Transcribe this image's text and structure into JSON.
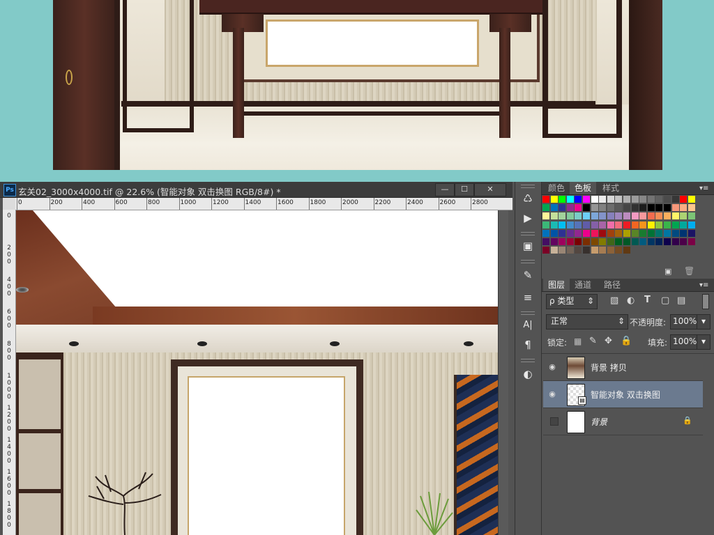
{
  "window": {
    "app_icon": "Ps",
    "title": "玄关02_3000x4000.tif @ 22.6% (智能对象 双击换图  RGB/8#) *",
    "minimize": "—",
    "restore": "☐",
    "close": "✕"
  },
  "ruler": {
    "horizontal": [
      "0",
      "200",
      "400",
      "600",
      "800",
      "1000",
      "1200",
      "1400",
      "1600",
      "1800",
      "2000",
      "2200",
      "2400",
      "2600",
      "2800"
    ],
    "vertical": [
      "0",
      "2 0 0",
      "4 0 0",
      "6 0 0",
      "8 0 0",
      "1 0 0 0",
      "1 2 0 0",
      "1 4 0 0",
      "1 6 0 0",
      "1 8 0 0"
    ]
  },
  "tools": [
    {
      "icon": "history-brush-icon",
      "glyph": "♺"
    },
    {
      "icon": "play-action-icon",
      "glyph": "▶"
    },
    {
      "icon": "properties-icon",
      "glyph": "▣"
    },
    {
      "icon": "brush-settings-icon",
      "glyph": "✎"
    },
    {
      "icon": "adjust-icon",
      "glyph": "≡"
    },
    {
      "icon": "character-icon",
      "glyph": "A|"
    },
    {
      "icon": "paragraph-icon",
      "glyph": "¶"
    },
    {
      "icon": "circle-mask-icon",
      "glyph": "◐"
    }
  ],
  "swatch_panel": {
    "tabs": [
      "颜色",
      "色板",
      "样式"
    ],
    "active_tab": "色板",
    "colors": [
      [
        "#ff0000",
        "#ffff00",
        "#00ff00",
        "#00ffff",
        "#0000ff",
        "#ff00ff",
        "#ffffff",
        "#ebebeb",
        "#d7d7d7",
        "#c3c3c3",
        "#afafaf",
        "#9b9b9b",
        "#878787",
        "#737373",
        "#5f5f5f",
        "#4b4b4b",
        "#373737",
        "#ff0000",
        "#ffff00"
      ],
      [
        "#00a651",
        "#0072bc",
        "#2e3192",
        "#92278f",
        "#ec008c",
        "#000000",
        "#959595",
        "#818181",
        "#6d6d6d",
        "#595959",
        "#454545",
        "#313131",
        "#1d1d1d",
        "#000000",
        "#000000",
        "#000000",
        "#f7977a",
        "#fbad82",
        "#fdc68c"
      ],
      [
        "#fff799",
        "#c4df9b",
        "#a3d39c",
        "#82ca9c",
        "#7accc8",
        "#6dcff6",
        "#7da7d9",
        "#8393ca",
        "#8781bd",
        "#a187be",
        "#bc8cbf",
        "#f49ac1",
        "#f6989d",
        "#f26c4f",
        "#f68e56",
        "#fbaf5d",
        "#fff568",
        "#acd373",
        "#7cc576"
      ],
      [
        "#3bb878",
        "#1abbb4",
        "#00bff3",
        "#448ccb",
        "#5674b9",
        "#605ca8",
        "#8560a8",
        "#a864a8",
        "#f06eaa",
        "#f26d7d",
        "#ed1c24",
        "#f26522",
        "#f7941d",
        "#fff200",
        "#8dc63f",
        "#39b54a",
        "#00a651",
        "#00a99d",
        "#00aeef"
      ],
      [
        "#0072bc",
        "#0054a6",
        "#2e3192",
        "#662d91",
        "#92278f",
        "#ec008c",
        "#ed145b",
        "#9e0b0f",
        "#a0410d",
        "#a3620a",
        "#aba000",
        "#598527",
        "#197b30",
        "#007236",
        "#00746b",
        "#0076a3",
        "#004a80",
        "#003471",
        "#1b1464"
      ],
      [
        "#440e62",
        "#630460",
        "#9e005d",
        "#9e0039",
        "#790000",
        "#7b2e00",
        "#7d4900",
        "#827b00",
        "#406618",
        "#005e20",
        "#005826",
        "#005952",
        "#005b7f",
        "#003663",
        "#002157",
        "#0d004c",
        "#32004b",
        "#4b0049",
        "#7b0046"
      ],
      [
        "#7a0026",
        "#c7b299",
        "#998675",
        "#736357",
        "#534741",
        "#37302d",
        "#c69c6d",
        "#a67c52",
        "#8c6239",
        "#754c24",
        "#603913"
      ]
    ]
  },
  "layers_panel": {
    "tabs": [
      "图层",
      "通道",
      "路径"
    ],
    "active_tab": "图层",
    "filter_label": "ρ 类型",
    "blend_mode": "正常",
    "opacity_label": "不透明度:",
    "opacity_value": "100%",
    "lock_label": "锁定:",
    "fill_label": "填充:",
    "fill_value": "100%",
    "layers": [
      {
        "name": "背景 拷贝",
        "visible": true,
        "selected": false,
        "locked": false
      },
      {
        "name": "智能对象 双击换图",
        "visible": true,
        "selected": true,
        "locked": false
      },
      {
        "name": "背景",
        "visible": false,
        "selected": false,
        "locked": true
      }
    ]
  },
  "colors": {
    "panel_bg": "#535353",
    "selected_layer": "#6b7a8f",
    "page_bg": "#82cac8"
  }
}
